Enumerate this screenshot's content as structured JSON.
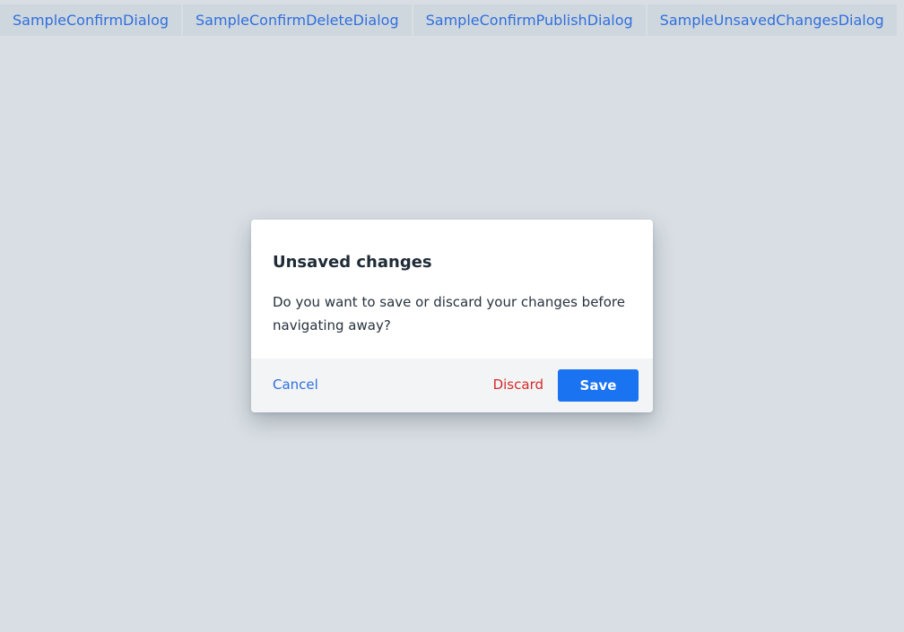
{
  "tabs": [
    {
      "label": "SampleConfirmDialog"
    },
    {
      "label": "SampleConfirmDeleteDialog"
    },
    {
      "label": "SampleConfirmPublishDialog"
    },
    {
      "label": "SampleUnsavedChangesDialog"
    }
  ],
  "dialog": {
    "title": "Unsaved changes",
    "message": "Do you want to save or discard your changes before navigating away?",
    "cancel_label": "Cancel",
    "discard_label": "Discard",
    "save_label": "Save"
  },
  "colors": {
    "page_background": "#d8dee3",
    "link_blue": "#2f6fdc",
    "danger_red": "#d62b2b",
    "primary_button": "#1a73f0",
    "footer_background": "#f2f4f6"
  }
}
